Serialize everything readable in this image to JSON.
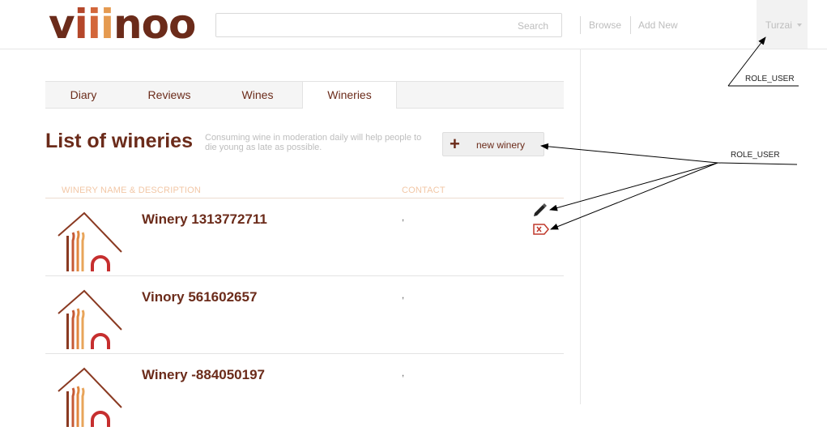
{
  "header": {
    "logo_text": [
      "v",
      "i",
      "i",
      "i",
      "noo"
    ],
    "search": {
      "placeholder": "",
      "button_label": "Search"
    },
    "nav": {
      "browse": "Browse",
      "add_new": "Add New"
    },
    "user": {
      "name": "Turzai"
    }
  },
  "tabs": [
    {
      "label": "Diary",
      "active": false
    },
    {
      "label": "Reviews",
      "active": false
    },
    {
      "label": "Wines",
      "active": false
    },
    {
      "label": "Wineries",
      "active": true
    }
  ],
  "page": {
    "title": "List of wineries",
    "tagline": "Consuming wine in moderation daily will help people to die young as late as possible.",
    "new_button_icon": "plus-icon",
    "new_button_label": "new winery"
  },
  "table": {
    "columns": [
      "WINERY NAME & DESCRIPTION",
      "CONTACT"
    ],
    "rows": [
      {
        "name": "Winery 1313772711",
        "contact": ","
      },
      {
        "name": "Vinory 561602657",
        "contact": ","
      },
      {
        "name": "Winery -884050197",
        "contact": ","
      }
    ],
    "row_actions": {
      "edit_icon": "pencil-icon",
      "delete_icon": "delete-tag-icon"
    }
  },
  "annotations": [
    {
      "label": "ROLE_USER"
    },
    {
      "label": "ROLE_USER"
    }
  ],
  "colors": {
    "brand": "#6b2b1a",
    "accent_orange": "#d3663a",
    "muted": "#bdbdbd",
    "delete_red": "#c0392b"
  }
}
